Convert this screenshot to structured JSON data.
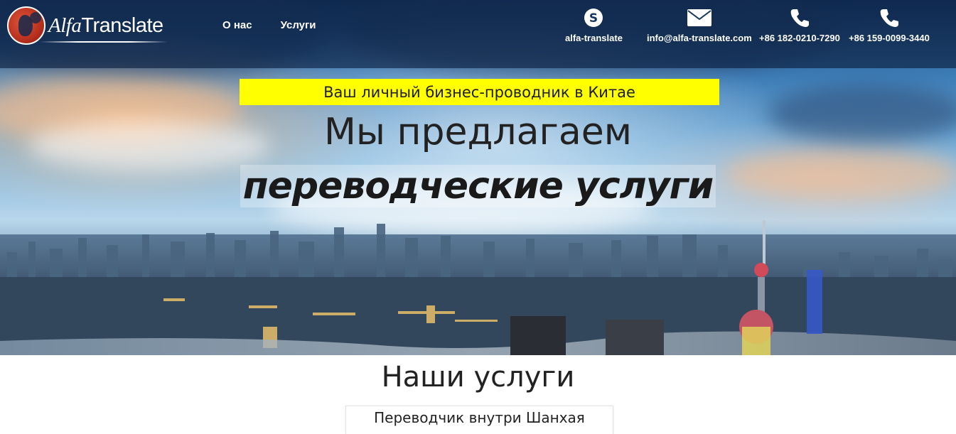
{
  "header": {
    "logo_text": "AlfaTranslate",
    "logo_alfa": "Alfa",
    "logo_translate": "Translate",
    "nav": [
      {
        "label": "О нас"
      },
      {
        "label": "Услуги"
      }
    ],
    "contacts": [
      {
        "icon": "skype-icon",
        "text": "alfa-translate"
      },
      {
        "icon": "mail-icon",
        "text": "info@alfa-translate.com"
      },
      {
        "icon": "phone-icon",
        "text": "+86 182-0210-7290"
      },
      {
        "icon": "phone-icon",
        "text": "+86 159-0099-3440"
      }
    ]
  },
  "hero": {
    "tagline": "Ваш личный бизнес-проводник в Китае",
    "headline_line1": "Мы предлагаем",
    "headline_line2": "переводческие услуги"
  },
  "services": {
    "title": "Наши услуги",
    "cards": [
      {
        "title": "Переводчик внутри Шанхая"
      }
    ]
  },
  "colors": {
    "tagline_bg": "#ffff00",
    "header_bg": "#081c3c",
    "logo_red": "#b8301e"
  }
}
